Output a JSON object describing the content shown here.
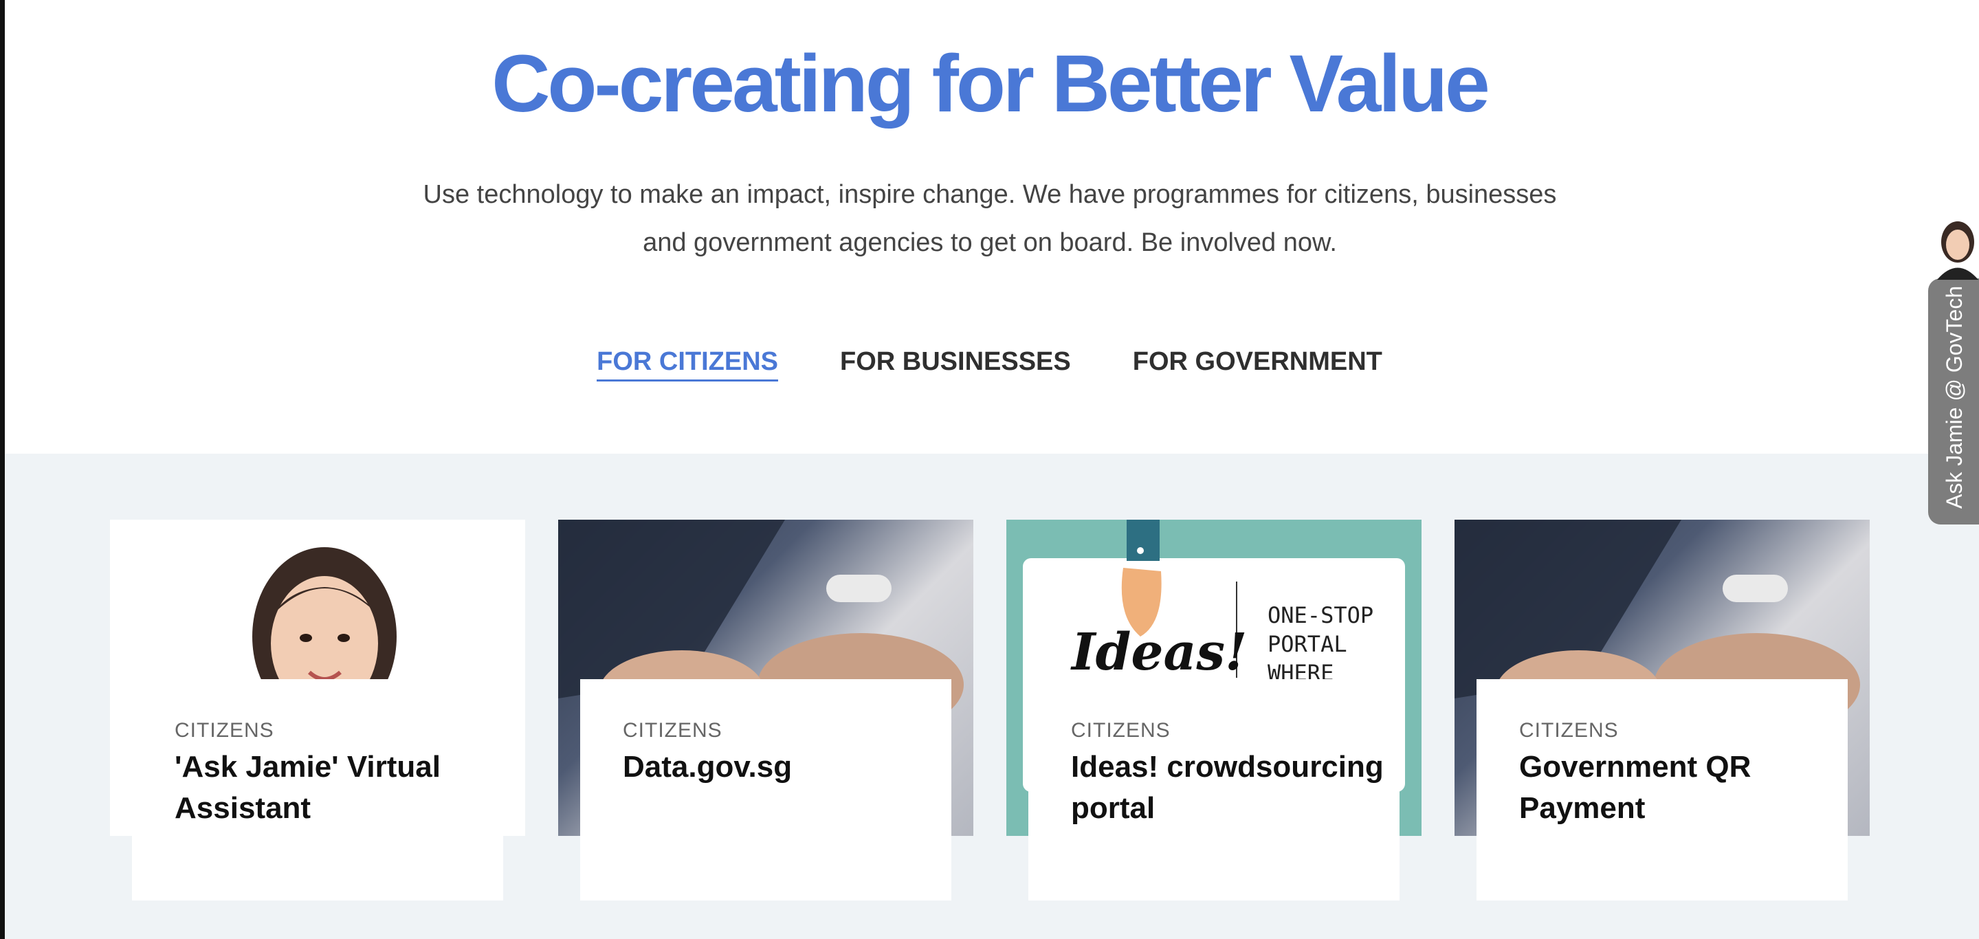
{
  "hero": {
    "title": "Co-creating for Better Value",
    "subtitle_line1": "Use technology to make an impact, inspire change. We have programmes for citizens, businesses",
    "subtitle_line2": "and government agencies to get on board. Be involved now."
  },
  "tabs": [
    {
      "label": "FOR CITIZENS",
      "active": true
    },
    {
      "label": "FOR BUSINESSES",
      "active": false
    },
    {
      "label": "FOR GOVERNMENT",
      "active": false
    }
  ],
  "cards": [
    {
      "category": "CITIZENS",
      "title": "'Ask Jamie' Virtual Assistant",
      "image": "woman-portrait"
    },
    {
      "category": "CITIZENS",
      "title": "Data.gov.sg",
      "image": "laptop-typing"
    },
    {
      "category": "CITIZENS",
      "title": "Ideas! crowdsourcing portal",
      "image": "ideas-banner",
      "image_text": {
        "logo": "Ideas!",
        "tagline_1": "ONE-STOP",
        "tagline_2": "PORTAL",
        "tagline_3": "WHERE"
      }
    },
    {
      "category": "CITIZENS",
      "title": "Government QR Payment",
      "image": "laptop-typing"
    }
  ],
  "floating_widget": {
    "label": "Ask Jamie @ GovTech"
  },
  "colors": {
    "accent": "#4a78d6",
    "band": "#eff3f6",
    "ideas_teal": "#7bbdb3",
    "widget": "#7d7d7d"
  }
}
